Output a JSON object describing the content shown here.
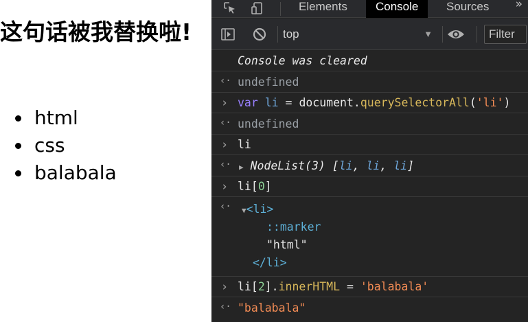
{
  "page": {
    "heading": "这句话被我替换啦!",
    "list_items": [
      "html",
      "css",
      "balabala"
    ]
  },
  "devtools": {
    "tabs": [
      "Elements",
      "Console",
      "Sources"
    ],
    "active_tab": "Console",
    "more_tabs_glyph": "»",
    "icons": {
      "inspect": "inspect-element-icon",
      "device": "device-toolbar-icon",
      "sidebar": "console-sidebar-icon",
      "clear": "clear-console-icon",
      "eye": "live-expression-eye-icon"
    },
    "toolbar": {
      "context": "top",
      "context_caret": "▼",
      "filter_placeholder": "Filter"
    },
    "console": {
      "cleared_message": "Console was cleared",
      "result_undefined": "undefined",
      "cmd1": {
        "kw": "var",
        "name": "li",
        "eq": " = ",
        "obj": "document.",
        "fn": "querySelectorAll",
        "open": "(",
        "arg": "'li'",
        "close": ")"
      },
      "cmd2": "li",
      "nodelist": {
        "label": "NodeList(3) [",
        "items": [
          "li",
          "li",
          "li"
        ],
        "sep": ", ",
        "close": "]"
      },
      "cmd3": {
        "name": "li[",
        "index": "0",
        "close": "]"
      },
      "element": {
        "open_tag": "<li>",
        "marker": "::marker",
        "text": "\"html\"",
        "close_tag": "</li>"
      },
      "cmd4": {
        "name": "li[",
        "index": "2",
        "close": "].",
        "prop": "innerHTML",
        "eq": " = ",
        "value": "'balabala'"
      },
      "result_final": "\"balabala\"",
      "prompt_glyph": "›",
      "result_glyph": "‹·"
    },
    "colors": {
      "panel_bg": "#242424",
      "toolbar_bg": "#292a2d",
      "active_tab_bg": "#000000",
      "keyword": "#9980ff",
      "variable": "#6fa8dc",
      "function": "#d7b75a",
      "string": "#f28b54",
      "number": "#8cd095",
      "tag": "#5db0d7"
    }
  }
}
